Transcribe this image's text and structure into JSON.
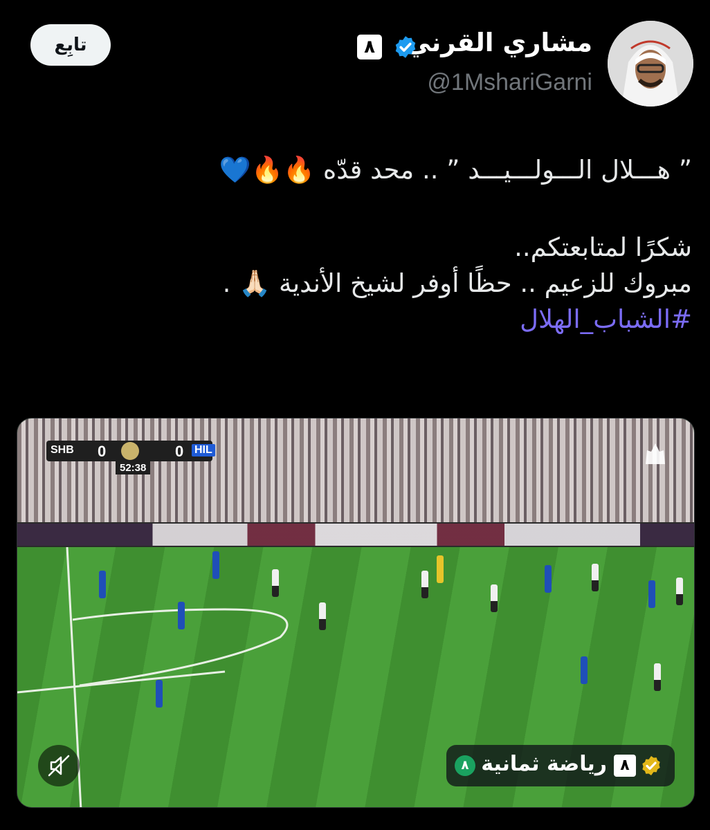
{
  "author": {
    "name": "مشاري القرني",
    "handle": "@1MshariGarni",
    "badge_text": "٨"
  },
  "follow_label": "تابِع",
  "tweet": {
    "line1": "” هـــلال الـــولـــيـــد ” .. محد قدّه 🔥🔥💙",
    "line2": "شكرًا لمتابعتكم..",
    "line3": "مبروك للزعيم .. حظًا أوفر لشيخ الأندية 🙏🏻 .",
    "hashtag": "#الشباب_الهلال"
  },
  "video": {
    "scorebug": {
      "team_left": "SHB",
      "score_left": "0",
      "score_right": "0",
      "team_right": "HIL",
      "clock": "52:38"
    },
    "source_chip": {
      "text": "رياضة ثمانية",
      "badge_text": "٨",
      "green_badge_text": "٨"
    }
  },
  "colors": {
    "verified": "#1d9bf0",
    "hashtag": "#7b6cf6",
    "follow_bg": "#eff3f4"
  }
}
